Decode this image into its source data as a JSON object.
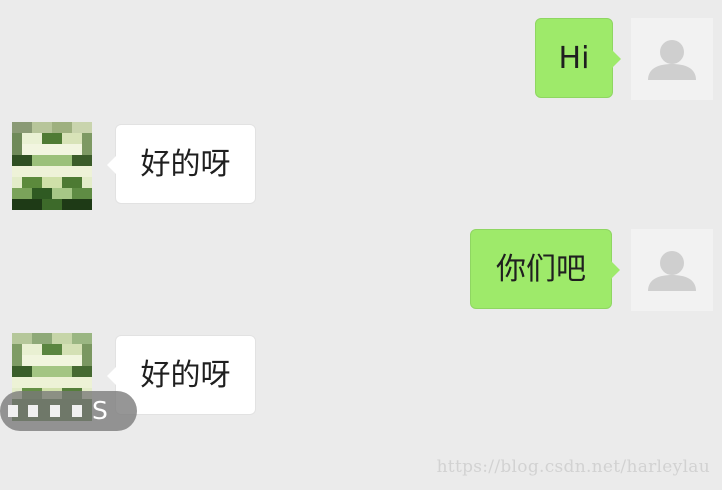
{
  "messages": [
    {
      "direction": "outgoing",
      "text": "Hi",
      "avatar_icon": "default-user-icon"
    },
    {
      "direction": "incoming",
      "text": "好的呀",
      "avatar_icon": "pixelated-avatar"
    },
    {
      "direction": "outgoing",
      "text": "你们吧",
      "avatar_icon": "default-user-icon"
    },
    {
      "direction": "incoming",
      "text": "好的呀",
      "avatar_icon": "pixelated-avatar"
    }
  ],
  "floating_pill": {
    "text": "S"
  },
  "watermark": "https://blog.csdn.net/harleylau",
  "colors": {
    "background": "#ebebeb",
    "outgoing_bubble": "#9eea6a",
    "incoming_bubble": "#ffffff",
    "avatar_placeholder": "#f2f2f2",
    "avatar_silhouette": "#cfcfcf"
  }
}
